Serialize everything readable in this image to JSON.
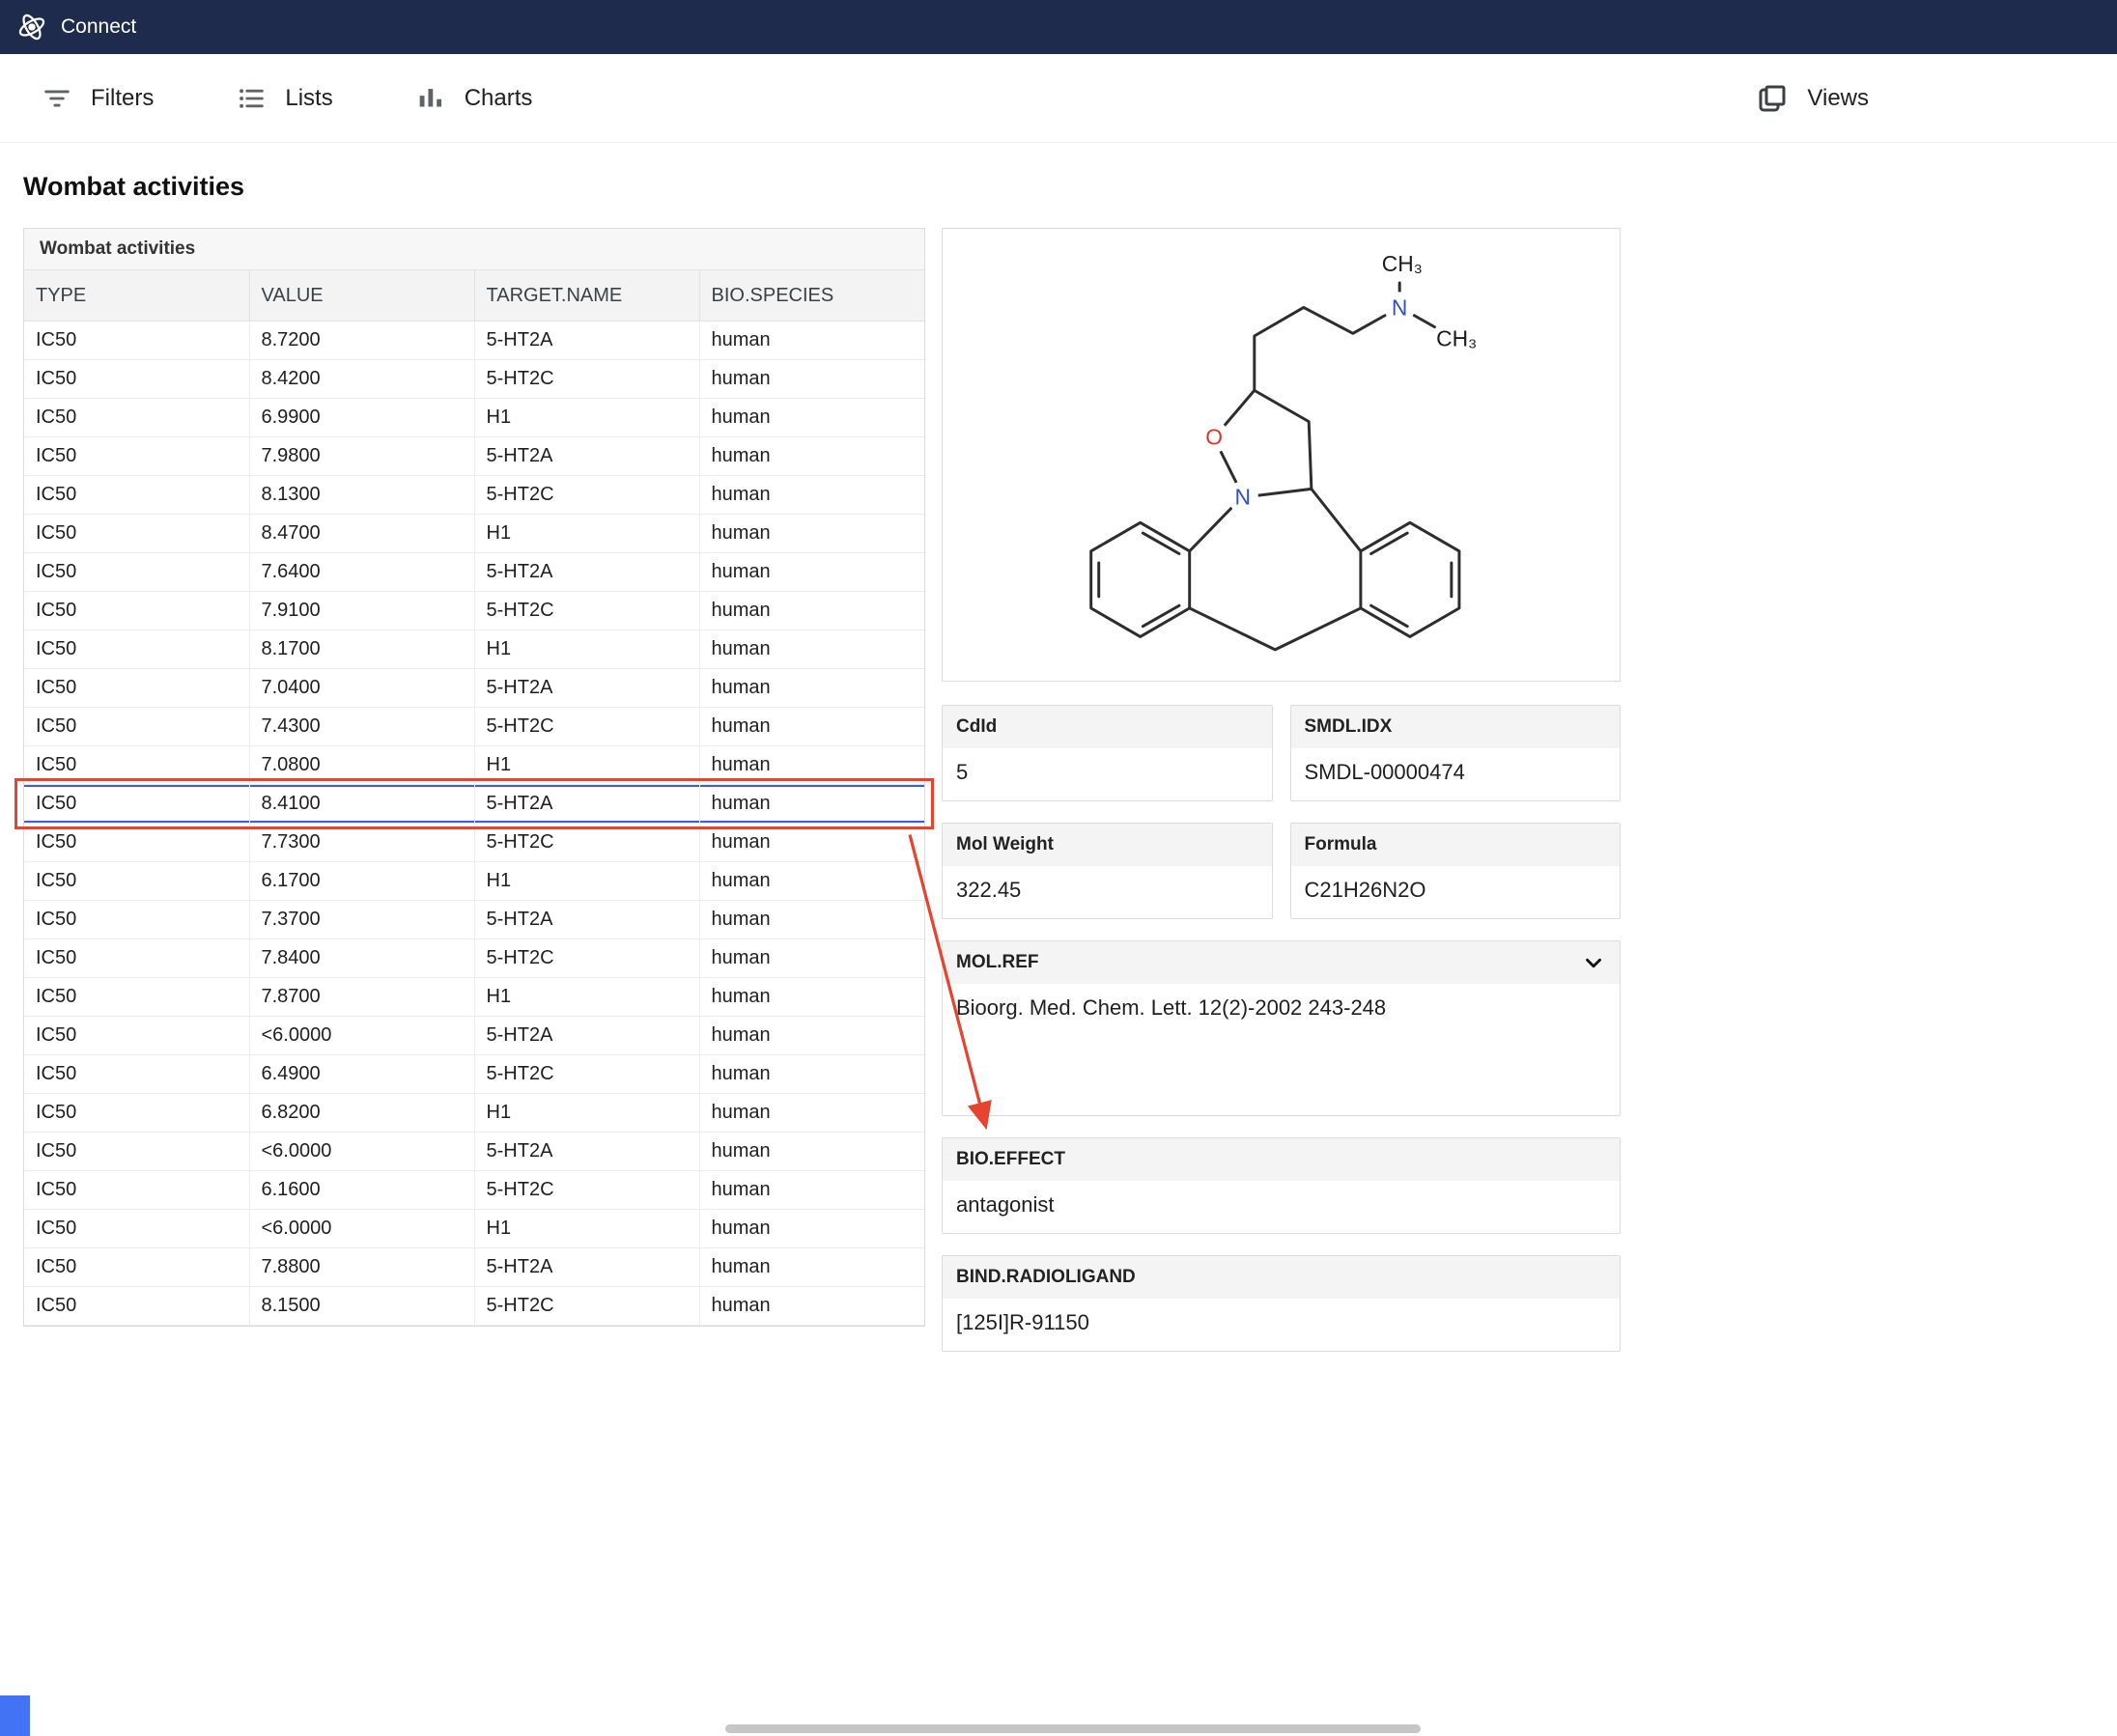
{
  "colors": {
    "topbar_bg": "#1e2b4d",
    "annotation": "#e8432e",
    "selection": "#3d5af0",
    "scroll_marker": "#4273f5"
  },
  "topbar": {
    "brand": "Connect"
  },
  "toolbar": {
    "items": [
      {
        "label": "Filters",
        "icon": "filter-icon"
      },
      {
        "label": "Lists",
        "icon": "list-icon"
      },
      {
        "label": "Charts",
        "icon": "bar-chart-icon"
      }
    ],
    "views_label": "Views"
  },
  "page": {
    "title": "Wombat activities"
  },
  "table": {
    "title": "Wombat activities",
    "columns": [
      "TYPE",
      "VALUE",
      "TARGET.NAME",
      "BIO.SPECIES"
    ],
    "selected_row_index": 12,
    "rows": [
      [
        "IC50",
        "8.7200",
        "5-HT2A",
        "human"
      ],
      [
        "IC50",
        "8.4200",
        "5-HT2C",
        "human"
      ],
      [
        "IC50",
        "6.9900",
        "H1",
        "human"
      ],
      [
        "IC50",
        "7.9800",
        "5-HT2A",
        "human"
      ],
      [
        "IC50",
        "8.1300",
        "5-HT2C",
        "human"
      ],
      [
        "IC50",
        "8.4700",
        "H1",
        "human"
      ],
      [
        "IC50",
        "7.6400",
        "5-HT2A",
        "human"
      ],
      [
        "IC50",
        "7.9100",
        "5-HT2C",
        "human"
      ],
      [
        "IC50",
        "8.1700",
        "H1",
        "human"
      ],
      [
        "IC50",
        "7.0400",
        "5-HT2A",
        "human"
      ],
      [
        "IC50",
        "7.4300",
        "5-HT2C",
        "human"
      ],
      [
        "IC50",
        "7.0800",
        "H1",
        "human"
      ],
      [
        "IC50",
        "8.4100",
        "5-HT2A",
        "human"
      ],
      [
        "IC50",
        "7.7300",
        "5-HT2C",
        "human"
      ],
      [
        "IC50",
        "6.1700",
        "H1",
        "human"
      ],
      [
        "IC50",
        "7.3700",
        "5-HT2A",
        "human"
      ],
      [
        "IC50",
        "7.8400",
        "5-HT2C",
        "human"
      ],
      [
        "IC50",
        "7.8700",
        "H1",
        "human"
      ],
      [
        "IC50",
        "<6.0000",
        "5-HT2A",
        "human"
      ],
      [
        "IC50",
        "6.4900",
        "5-HT2C",
        "human"
      ],
      [
        "IC50",
        "6.8200",
        "H1",
        "human"
      ],
      [
        "IC50",
        "<6.0000",
        "5-HT2A",
        "human"
      ],
      [
        "IC50",
        "6.1600",
        "5-HT2C",
        "human"
      ],
      [
        "IC50",
        "<6.0000",
        "H1",
        "human"
      ],
      [
        "IC50",
        "7.8800",
        "5-HT2A",
        "human"
      ],
      [
        "IC50",
        "8.1500",
        "5-HT2C",
        "human"
      ]
    ]
  },
  "details": {
    "cards": [
      {
        "label": "CdId",
        "value": "5"
      },
      {
        "label": "SMDL.IDX",
        "value": "SMDL-00000474"
      },
      {
        "label": "Mol Weight",
        "value": "322.45"
      },
      {
        "label": "Formula",
        "value": "C21H26N2O"
      }
    ],
    "mol_ref": {
      "label": "MOL.REF",
      "value": "Bioorg. Med. Chem. Lett. 12(2)-2002 243-248"
    },
    "bio_effect": {
      "label": "BIO.EFFECT",
      "value": "antagonist"
    },
    "bind_radioligand": {
      "label": "BIND.RADIOLIGAND",
      "value": "[125I]R-91150"
    }
  },
  "molecule": {
    "labels": {
      "ch3_top": "CH₃",
      "n_amine": "N",
      "ch3_right": "CH₃",
      "o_ring": "O",
      "n_ring": "N"
    }
  }
}
